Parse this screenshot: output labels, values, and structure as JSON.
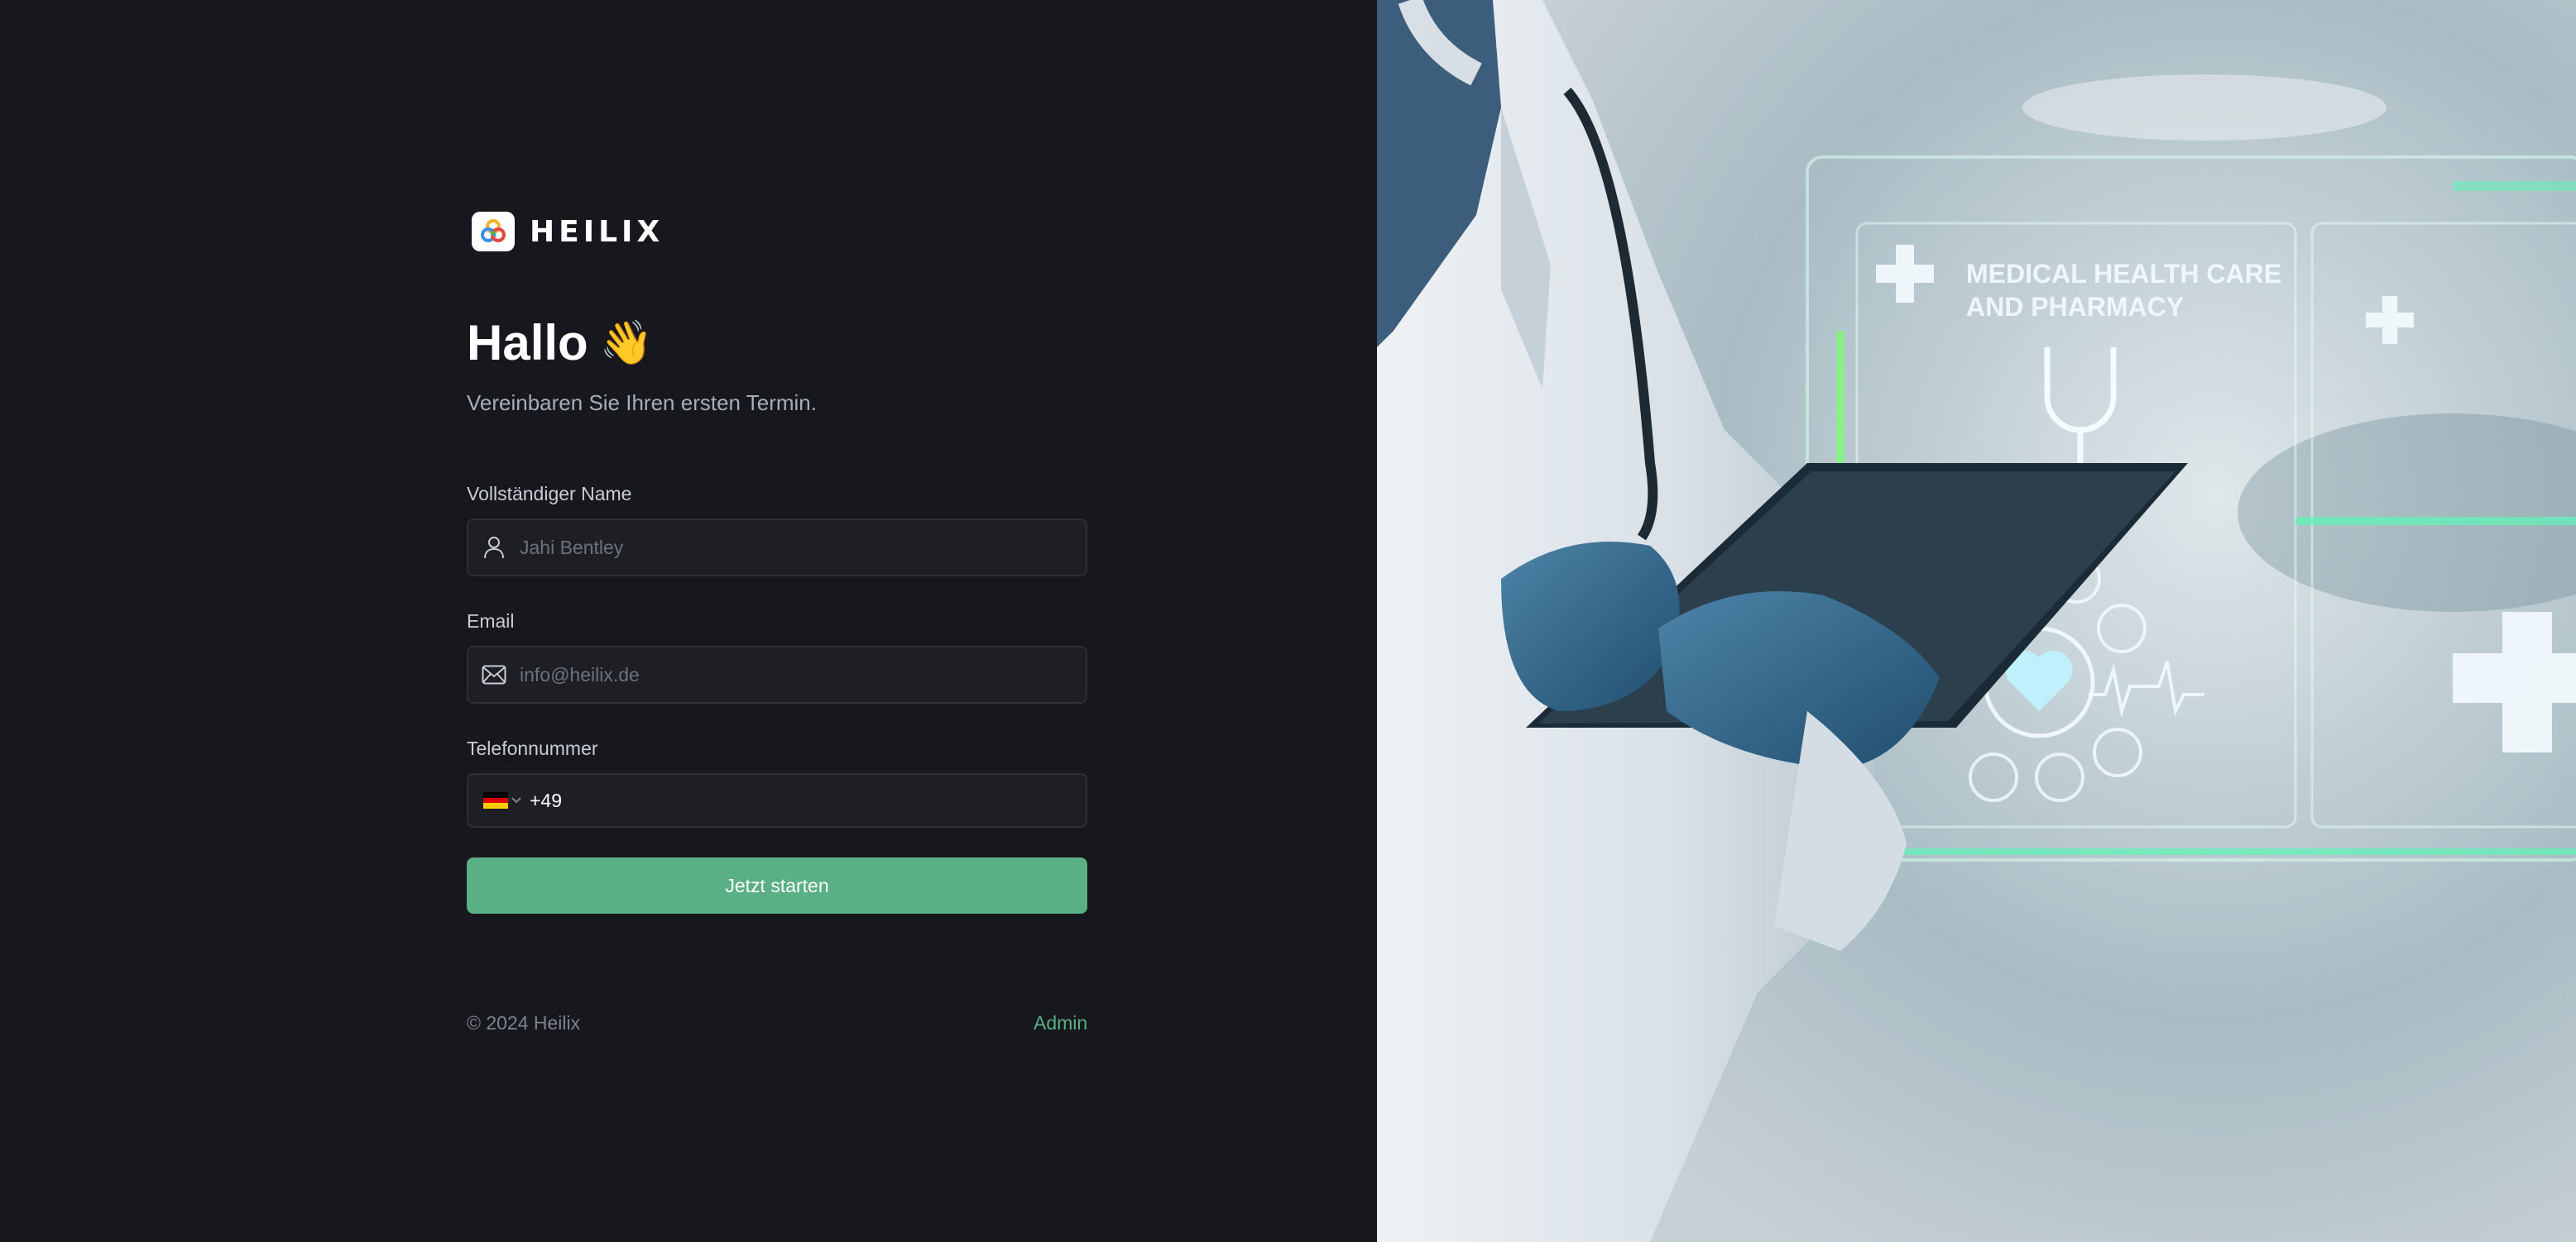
{
  "brand": {
    "name": "HEILIX",
    "colors": {
      "accent": "#5aaf85",
      "background": "#16181d",
      "field_bg": "#1d1f24"
    }
  },
  "greeting": {
    "title": "Hallo",
    "emoji": "👋",
    "subtitle": "Vereinbaren Sie Ihren ersten Termin."
  },
  "form": {
    "name": {
      "label": "Vollständiger Name",
      "placeholder": "Jahi Bentley",
      "value": "",
      "icon": "user-icon"
    },
    "email": {
      "label": "Email",
      "placeholder": "info@heilix.de",
      "value": "",
      "icon": "mail-icon"
    },
    "phone": {
      "label": "Telefonnummer",
      "country": "DE",
      "dial_code": "+49",
      "value": ""
    },
    "submit_label": "Jetzt starten"
  },
  "footer": {
    "copyright": "© 2024 Heilix",
    "admin_label": "Admin"
  },
  "hero": {
    "icon": "doctor-tablet-photo",
    "overlay_text": [
      "MEDICAL HEALTH CARE",
      "AND PHARMACY"
    ]
  }
}
